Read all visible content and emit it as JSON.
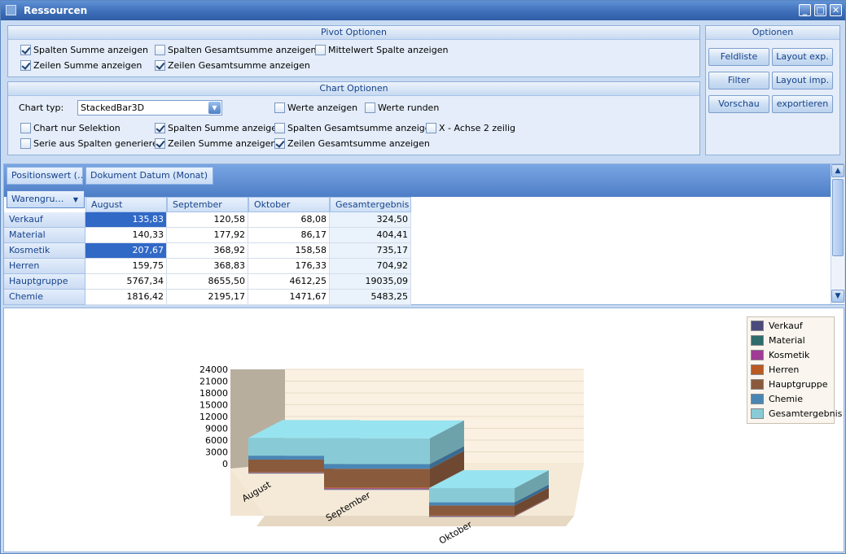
{
  "window": {
    "title": "Ressourcen",
    "minimize": "_",
    "maximize": "□",
    "close": "✕"
  },
  "pivot_options": {
    "header": "Pivot Optionen",
    "items": [
      {
        "label": "Spalten Summe anzeigen",
        "checked": true
      },
      {
        "label": "Spalten Gesamtsumme anzeigen",
        "checked": false
      },
      {
        "label": "Mittelwert Spalte anzeigen",
        "checked": false
      },
      {
        "label": "Zeilen Summe anzeigen",
        "checked": true
      },
      {
        "label": "Zeilen Gesamtsumme anzeigen",
        "checked": true
      }
    ]
  },
  "chart_options": {
    "header": "Chart Optionen",
    "chart_type_label": "Chart typ:",
    "chart_type_value": "StackedBar3D",
    "items": [
      {
        "label": "Werte anzeigen",
        "checked": false
      },
      {
        "label": "Werte runden",
        "checked": false
      },
      {
        "label": "Chart nur Selektion",
        "checked": false
      },
      {
        "label": "Spalten Summe anzeigen",
        "checked": true
      },
      {
        "label": "Spalten Gesamtsumme anzeigen",
        "checked": false
      },
      {
        "label": "X - Achse 2 zeilig",
        "checked": false
      },
      {
        "label": "Serie aus Spalten generieren",
        "checked": false
      },
      {
        "label": "Zeilen Summe anzeigen",
        "checked": true
      },
      {
        "label": "Zeilen Gesamtsumme anzeigen",
        "checked": true
      }
    ]
  },
  "optionen": {
    "header": "Optionen",
    "buttons": [
      "Feldliste",
      "Layout exp.",
      "Filter",
      "Layout imp.",
      "Vorschau",
      "exportieren"
    ]
  },
  "pivot": {
    "filter_field": "Positionswert (…",
    "column_field": "Dokument Datum (Monat)",
    "column_field_sort": "▲",
    "row_field": "Warengru…",
    "row_field_arrow": "▼",
    "columns": [
      "August",
      "September",
      "Oktober",
      "Gesamtergebnis"
    ],
    "rows": [
      {
        "label": "Verkauf",
        "values": [
          "135,83",
          "120,58",
          "68,08",
          "324,50"
        ]
      },
      {
        "label": "Material",
        "values": [
          "140,33",
          "177,92",
          "86,17",
          "404,41"
        ]
      },
      {
        "label": "Kosmetik",
        "values": [
          "207,67",
          "368,92",
          "158,58",
          "735,17"
        ]
      },
      {
        "label": "Herren",
        "values": [
          "159,75",
          "368,83",
          "176,33",
          "704,92"
        ]
      },
      {
        "label": "Hauptgruppe",
        "values": [
          "5767,34",
          "8655,50",
          "4612,25",
          "19035,09"
        ]
      },
      {
        "label": "Chemie",
        "values": [
          "1816,42",
          "2195,17",
          "1471,67",
          "5483,25"
        ]
      }
    ],
    "scroll_up": "▲",
    "scroll_down": "▼"
  },
  "chart_data": {
    "type": "bar",
    "stacked": true,
    "three_d": true,
    "categories": [
      "August",
      "September",
      "Oktober"
    ],
    "series": [
      {
        "name": "Verkauf",
        "values": [
          135.83,
          120.58,
          68.08
        ],
        "color": "#4a4a7c"
      },
      {
        "name": "Material",
        "values": [
          140.33,
          177.92,
          86.17
        ],
        "color": "#2f6c6c"
      },
      {
        "name": "Kosmetik",
        "values": [
          207.67,
          368.92,
          158.58
        ],
        "color": "#a03c94"
      },
      {
        "name": "Herren",
        "values": [
          159.75,
          368.83,
          176.33
        ],
        "color": "#b85a24"
      },
      {
        "name": "Hauptgruppe",
        "values": [
          5767.34,
          8655.5,
          4612.25
        ],
        "color": "#8a5a3c"
      },
      {
        "name": "Chemie",
        "values": [
          1816.42,
          2195.17,
          1471.67
        ],
        "color": "#4a86b4"
      },
      {
        "name": "Gesamtergebnis",
        "values": [
          8227.34,
          11886.92,
          6573.08
        ],
        "color": "#88cbd6"
      }
    ],
    "yticks": [
      "24000",
      "21000",
      "18000",
      "15000",
      "12000",
      "9000",
      "6000",
      "3000",
      "0"
    ],
    "ylim": [
      0,
      24000
    ],
    "legend_position": "top-right",
    "grid": true
  }
}
